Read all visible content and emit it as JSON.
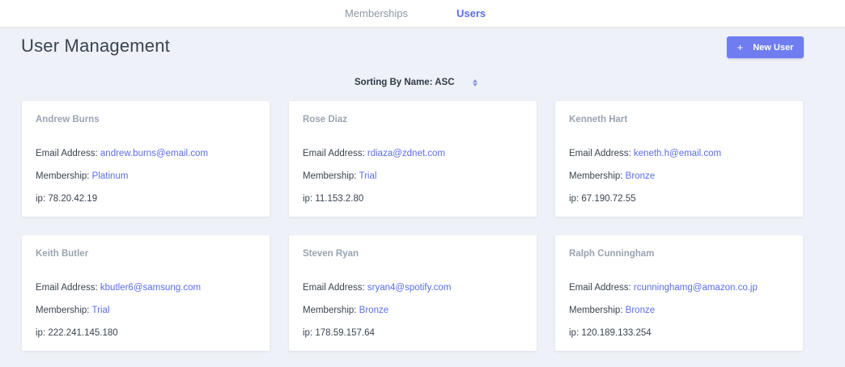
{
  "nav": {
    "tabs": [
      {
        "label": "Memberships"
      },
      {
        "label": "Users"
      }
    ]
  },
  "header": {
    "title": "User Management",
    "new_user_label": "New User",
    "plus_icon": "+"
  },
  "sort": {
    "label": "Sorting By Name: ASC"
  },
  "labels": {
    "email": "Email Address: ",
    "membership": "Membership: ",
    "ip": "ip: "
  },
  "colors": {
    "accent": "#5b6df0",
    "button": "#6f7df0",
    "background": "#eef1f7"
  },
  "users": [
    {
      "name": "Andrew Burns",
      "email": "andrew.burns@email.com",
      "membership": "Platinum",
      "ip": "78.20.42.19"
    },
    {
      "name": "Rose Diaz",
      "email": "rdiaza@zdnet.com",
      "membership": "Trial",
      "ip": "11.153.2.80"
    },
    {
      "name": "Kenneth Hart",
      "email": "keneth.h@email.com",
      "membership": "Bronze",
      "ip": "67.190.72.55"
    },
    {
      "name": "Keith Butler",
      "email": "kbutler6@samsung.com",
      "membership": "Trial",
      "ip": "222.241.145.180"
    },
    {
      "name": "Steven Ryan",
      "email": "sryan4@spotify.com",
      "membership": "Bronze",
      "ip": "178.59.157.64"
    },
    {
      "name": "Ralph Cunningham",
      "email": "rcunninghamg@amazon.co.jp",
      "membership": "Bronze",
      "ip": "120.189.133.254"
    }
  ]
}
